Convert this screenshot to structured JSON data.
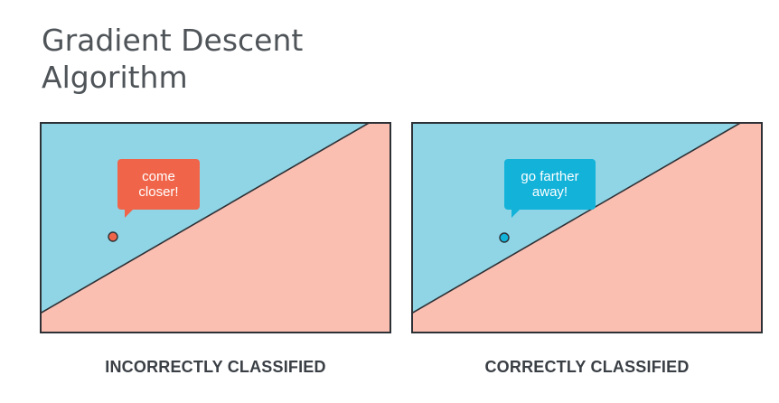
{
  "title": {
    "line1": "Gradient Descent",
    "line2": "Algorithm"
  },
  "colors": {
    "blue_region": "#8fd5e6",
    "red_region": "#fbbfb2",
    "bubble_red": "#f0654a",
    "bubble_blue": "#12b2d9",
    "border": "#2d3136"
  },
  "panels": [
    {
      "bubble_line1": "come",
      "bubble_line2": "closer!",
      "point_color": "red",
      "caption": "INCORRECTLY CLASSIFIED"
    },
    {
      "bubble_line1": "go farther",
      "bubble_line2": "away!",
      "point_color": "blue",
      "caption": "CORRECTLY CLASSIFIED"
    }
  ]
}
